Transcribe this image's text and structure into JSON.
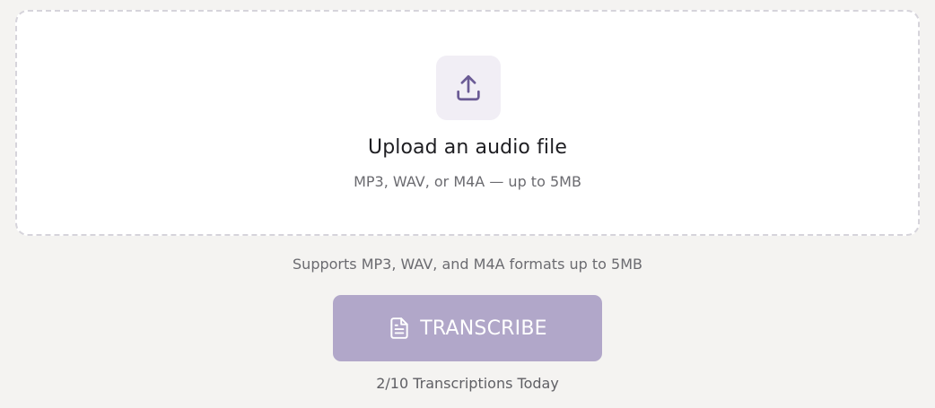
{
  "upload": {
    "icon": "upload-icon",
    "title": "Upload an audio file",
    "subtitle": "MP3, WAV, or M4A — up to 5MB"
  },
  "support_text": "Supports MP3, WAV, and M4A formats up to 5MB",
  "transcribe_button": {
    "icon": "document-icon",
    "label": "TRANSCRIBE"
  },
  "usage": {
    "text": "2/10 Transcriptions Today"
  },
  "colors": {
    "accent": "#6b5b95",
    "button_bg": "#b1a7c9",
    "icon_box_bg": "#f1eef5",
    "page_bg": "#f4f3f1"
  }
}
